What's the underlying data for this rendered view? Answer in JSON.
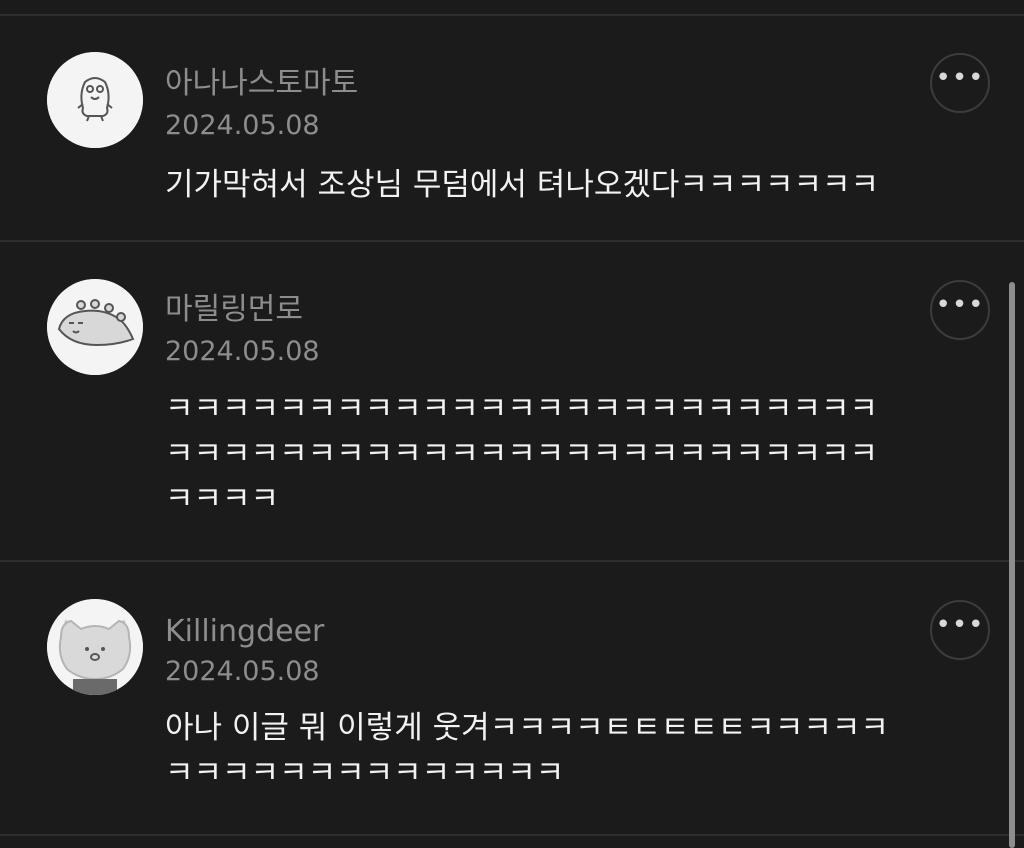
{
  "comments": [
    {
      "username": "아나나스토마토",
      "date": "2024.05.08",
      "lines": [
        "기가막혀서 조상님 무덤에서 텨나오겠다ㅋㅋㅋㅋㅋㅋㅋ"
      ],
      "avatar_icon": "duck-character-icon",
      "more_icon": "more-options-icon"
    },
    {
      "username": "마릴링먼로",
      "date": "2024.05.08",
      "lines": [
        "ㅋㅋㅋㅋㅋㅋㅋㅋㅋㅋㅋㅋㅋㅋㅋㅋㅋㅋㅋㅋㅋㅋㅋㅋㅋ",
        "ㅋㅋㅋㅋㅋㅋㅋㅋㅋㅋㅋㅋㅋㅋㅋㅋㅋㅋㅋㅋㅋㅋㅋㅋㅋ",
        "ㅋㅋㅋㅋ"
      ],
      "avatar_icon": "dinosaur-character-icon",
      "more_icon": "more-options-icon"
    },
    {
      "username": "Killingdeer",
      "date": "2024.05.08",
      "lines": [
        "아나 이글 뭐 이렇게 웃겨ㅋㅋㅋㅋㅌㅌㅌㅌㅌㅋㅋㅋㅋㅋ",
        "ㅋㅋㅋㅋㅋㅋㅋㅋㅋㅋㅋㅋㅋㅋ"
      ],
      "avatar_icon": "cat-character-icon",
      "more_icon": "more-options-icon"
    }
  ],
  "more_button_glyph": "•••",
  "colors": {
    "background": "#1b1b1c",
    "divider": "#2e2e30",
    "meta_text": "#8d8d8f",
    "body_text": "#f2f2f2",
    "avatar_bg": "#f4f4f4"
  }
}
